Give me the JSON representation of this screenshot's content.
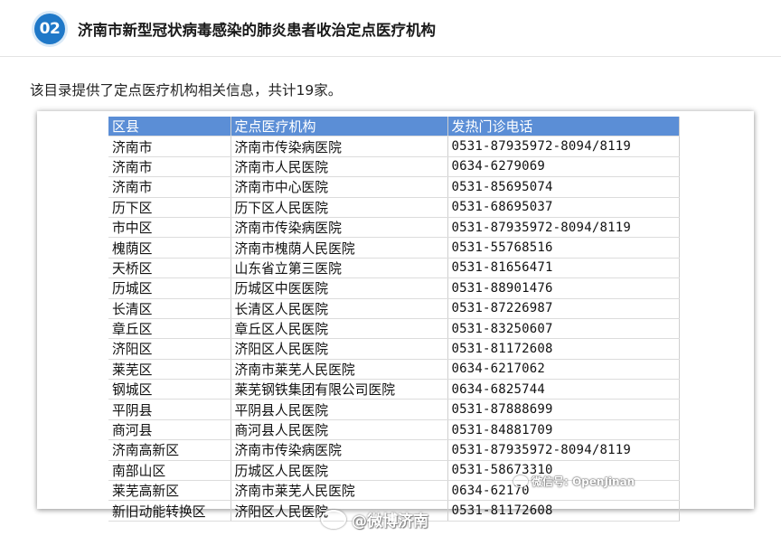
{
  "header": {
    "badge": "02",
    "title": "济南市新型冠状病毒感染的肺炎患者收治定点医疗机构"
  },
  "intro": "该目录提供了定点医疗机构相关信息，共计19家。",
  "table": {
    "headers": [
      "区县",
      "定点医疗机构",
      "发热门诊电话"
    ],
    "rows": [
      [
        "济南市",
        "济南市传染病医院",
        "0531-87935972-8094/8119"
      ],
      [
        "济南市",
        "济南市人民医院",
        "0634-6279069"
      ],
      [
        "济南市",
        "济南市中心医院",
        "0531-85695074"
      ],
      [
        "历下区",
        "历下区人民医院",
        "0531-68695037"
      ],
      [
        "市中区",
        "济南市传染病医院",
        "0531-87935972-8094/8119"
      ],
      [
        "槐荫区",
        "济南市槐荫人民医院",
        "0531-55768516"
      ],
      [
        "天桥区",
        "山东省立第三医院",
        "0531-81656471"
      ],
      [
        "历城区",
        "历城区中医医院",
        "0531-88901476"
      ],
      [
        "长清区",
        "长清区人民医院",
        "0531-87226987"
      ],
      [
        "章丘区",
        "章丘区人民医院",
        "0531-83250607"
      ],
      [
        "济阳区",
        "济阳区人民医院",
        "0531-81172608"
      ],
      [
        "莱芜区",
        "济南市莱芜人民医院",
        "0634-6217062"
      ],
      [
        "钢城区",
        "莱芜钢铁集团有限公司医院",
        "0634-6825744"
      ],
      [
        "平阴县",
        "平阴县人民医院",
        "0531-87888699"
      ],
      [
        "商河县",
        "商河县人民医院",
        "0531-84881709"
      ],
      [
        "济南高新区",
        "济南市传染病医院",
        "0531-87935972-8094/8119"
      ],
      [
        "南部山区",
        "历城区人民医院",
        "0531-58673310"
      ],
      [
        "莱芜高新区",
        "济南市莱芜人民医院",
        "0634-62170"
      ],
      [
        "新旧动能转换区",
        "济阳区人民医院",
        "0531-81172608"
      ]
    ]
  },
  "watermarks": {
    "wechat": "微信号: OpenJinan",
    "weibo": "@微博济南"
  }
}
